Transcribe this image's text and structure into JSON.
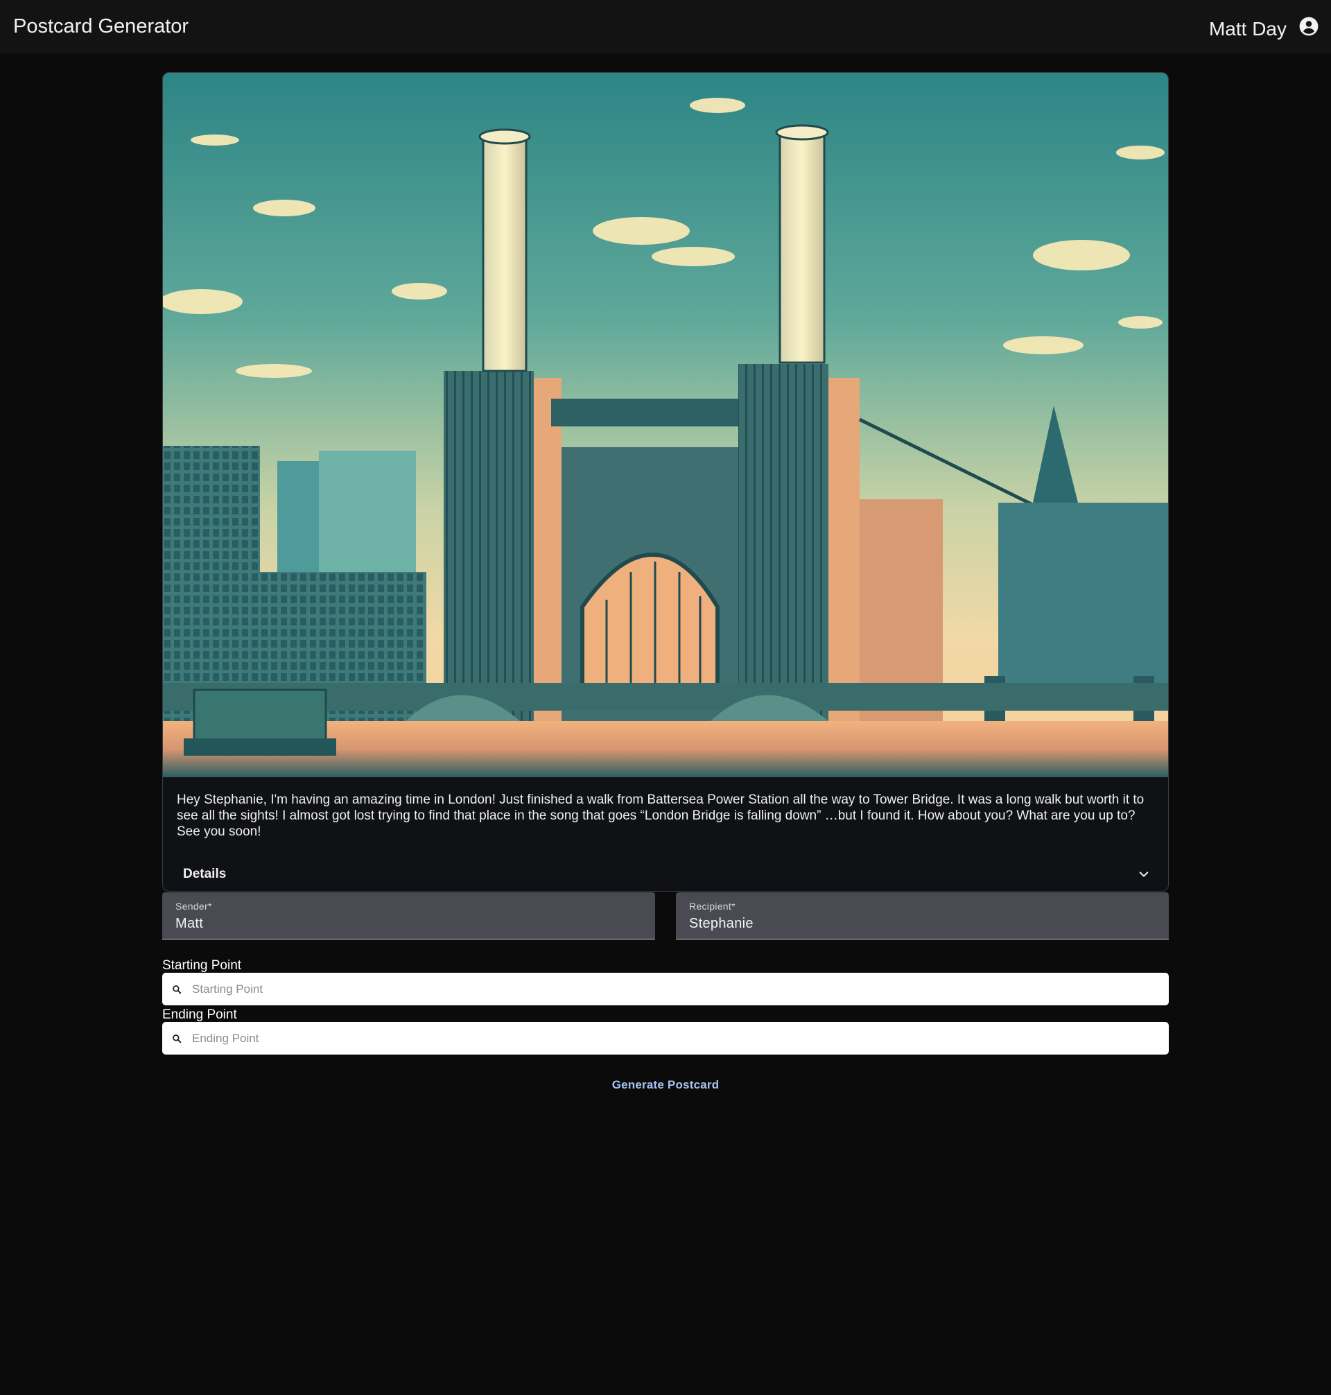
{
  "header": {
    "app_title": "Postcard Generator",
    "user_name": "Matt Day",
    "account_icon": "account-circle-icon"
  },
  "postcard": {
    "image_subject": "Battersea Power Station illustration",
    "message": "Hey Stephanie, I'm having an amazing time in London! Just finished a walk from Battersea Power Station all the way to Tower Bridge. It was a long walk but worth it to see all the sights! I almost got lost trying to find that place in the song that goes “London Bridge is falling down” …but I found it. How about you? What are you up to? See you soon!",
    "details_label": "Details",
    "details_icon": "chevron-down-icon"
  },
  "form": {
    "sender": {
      "label": "Sender*",
      "value": "Matt"
    },
    "recipient": {
      "label": "Recipient*",
      "value": "Stephanie"
    },
    "starting_point": {
      "label": "Starting Point",
      "placeholder": "Starting Point"
    },
    "ending_point": {
      "label": "Ending Point",
      "placeholder": "Ending Point"
    },
    "generate_label": "Generate Postcard"
  },
  "colors": {
    "background": "#0b0b0c",
    "topbar": "#131313",
    "text_field_fill": "#4a4b52",
    "button_text": "#a8c2f0"
  }
}
